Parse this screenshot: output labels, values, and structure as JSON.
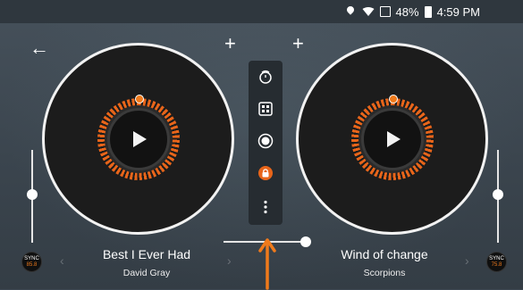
{
  "status_bar": {
    "battery": "48%",
    "time": "4:59 PM"
  },
  "deck_left": {
    "title": "Best I Ever Had",
    "artist": "David Gray",
    "sync_label": "SYNC",
    "bpm": "85.8",
    "pitch_level": 0.45
  },
  "deck_right": {
    "title": "Wind of change",
    "artist": "Scorpions",
    "sync_label": "SYNC",
    "bpm": "75.8",
    "pitch_level": 0.45
  },
  "crossfader": {
    "position": 1.0
  },
  "icons": {
    "back": "arrow-left-icon",
    "add_left": "plus-icon",
    "add_right": "plus-icon",
    "toolbar": [
      "tomato-timer-icon",
      "grid-pads-icon",
      "record-icon",
      "lock-icon",
      "more-vertical-icon"
    ]
  },
  "colors": {
    "accent": "#f07a1b",
    "platter": "#1c1c1c",
    "background": "#3c4650"
  }
}
